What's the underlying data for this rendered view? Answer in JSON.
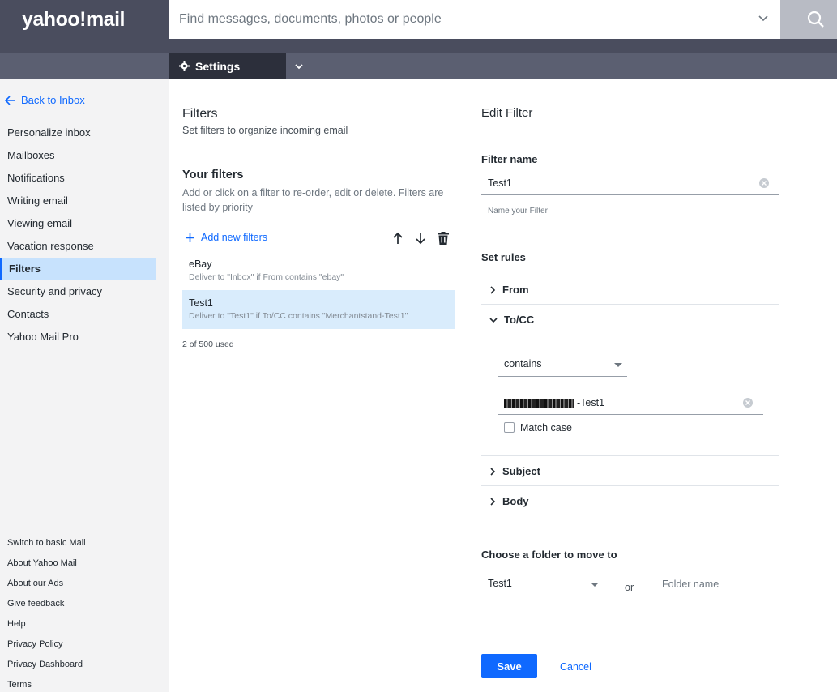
{
  "brand": {
    "logo": "yahoo!mail"
  },
  "search": {
    "placeholder": "Find messages, documents, photos or people"
  },
  "tabs": {
    "settings_label": "Settings"
  },
  "sidebar": {
    "back_label": "Back to Inbox",
    "items": [
      {
        "label": "Personalize inbox"
      },
      {
        "label": "Mailboxes"
      },
      {
        "label": "Notifications"
      },
      {
        "label": "Writing email"
      },
      {
        "label": "Viewing email"
      },
      {
        "label": "Vacation response"
      },
      {
        "label": "Filters",
        "active": true
      },
      {
        "label": "Security and privacy"
      },
      {
        "label": "Contacts"
      },
      {
        "label": "Yahoo Mail Pro"
      }
    ],
    "footer": [
      {
        "label": "Switch to basic Mail"
      },
      {
        "label": "About Yahoo Mail"
      },
      {
        "label": "About our Ads"
      },
      {
        "label": "Give feedback"
      },
      {
        "label": "Help"
      },
      {
        "label": "Privacy Policy"
      },
      {
        "label": "Privacy Dashboard"
      },
      {
        "label": "Terms"
      }
    ]
  },
  "filters": {
    "title": "Filters",
    "subtitle": "Set filters to organize incoming email",
    "your_filters_title": "Your filters",
    "your_filters_desc": "Add or click on a filter to re-order, edit or delete. Filters are listed by priority",
    "add_label": "Add new filters",
    "list": [
      {
        "name": "eBay",
        "description": "Deliver to \"Inbox\" if From contains \"ebay\""
      },
      {
        "name": "Test1",
        "description": "Deliver to \"Test1\" if To/CC contains \"Merchantstand-Test1\"",
        "selected": true
      }
    ],
    "usage": "2 of 500 used"
  },
  "edit": {
    "title": "Edit Filter",
    "name_label": "Filter name",
    "name_value": "Test1",
    "name_hint": "Name your Filter",
    "rules_label": "Set rules",
    "rules": {
      "from": "From",
      "tocc": "To/CC",
      "subject": "Subject",
      "body": "Body"
    },
    "tocc_condition": "contains",
    "tocc_value_suffix": "-Test1",
    "match_case_label": "Match case",
    "folder_label": "Choose a folder to move to",
    "folder_selected": "Test1",
    "or_label": "or",
    "folder_name_placeholder": "Folder name",
    "save_label": "Save",
    "cancel_label": "Cancel"
  },
  "colors": {
    "accent": "#0f69ff",
    "header": "#4a4d5e",
    "selected_bg": "#d9ecfc"
  }
}
